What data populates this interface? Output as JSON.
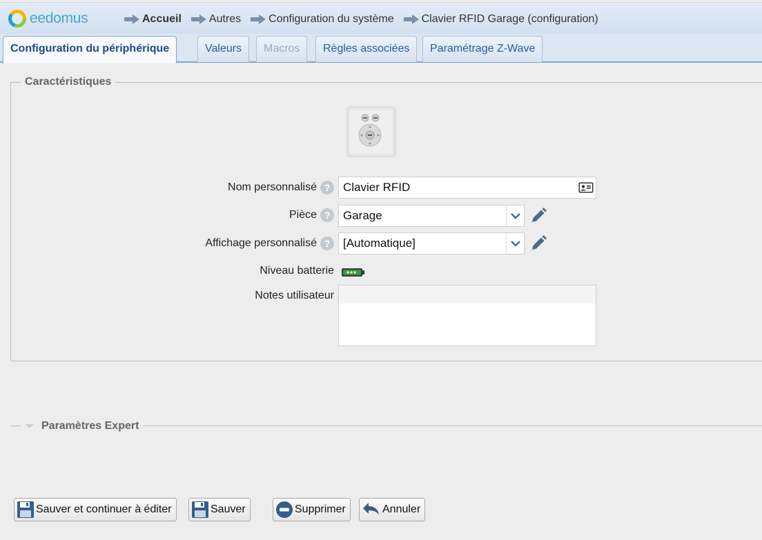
{
  "header": {
    "brand": "eedomus",
    "breadcrumb": [
      "Accueil",
      "Autres",
      "Configuration du système",
      "Clavier RFID Garage (configuration)"
    ]
  },
  "tabs": [
    {
      "label": "Configuration du périphérique",
      "state": "active"
    },
    {
      "label": "Valeurs",
      "state": "normal"
    },
    {
      "label": "Macros",
      "state": "disabled"
    },
    {
      "label": "Règles associées",
      "state": "normal"
    },
    {
      "label": "Paramétrage Z-Wave",
      "state": "normal"
    }
  ],
  "characteristics": {
    "legend": "Caractéristiques",
    "device_image": "rfid-keypad-device",
    "name_label": "Nom personnalisé",
    "name_value": "Clavier RFID",
    "room_label": "Pièce",
    "room_value": "Garage",
    "display_label": "Affichage personnalisé",
    "display_value": "[Automatique]",
    "battery_label": "Niveau batterie",
    "battery_level": 1.0,
    "notes_label": "Notes utilisateur",
    "notes_value": ""
  },
  "expert": {
    "legend": "Paramètres Expert"
  },
  "buttons": {
    "save_continue": "Sauver et continuer à éditer",
    "save": "Sauver",
    "delete": "Supprimer",
    "cancel": "Annuler"
  },
  "colors": {
    "accent": "#2b5ba2",
    "battery": "#2e9e3a"
  }
}
